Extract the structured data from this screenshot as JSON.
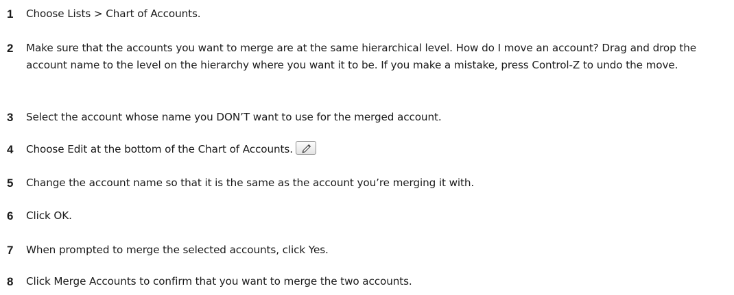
{
  "steps": [
    {
      "number": "1",
      "text": "Choose Lists > Chart of Accounts."
    },
    {
      "number": "2",
      "text": "Make sure that the accounts you want to merge are at the same hierarchical level. How do I move an account? Drag and drop the account name to the level on the hierarchy where you want it to be. If you make a mistake, press Control-Z to undo the move."
    },
    {
      "number": "3",
      "text": "Select the account whose name you DON’T want to use for the merged account."
    },
    {
      "number": "4",
      "text": "Choose Edit at the bottom of the Chart of Accounts.",
      "icon": "pencil-icon"
    },
    {
      "number": "5",
      "text": "Change the account name so that it is the same as the account you’re merging it with."
    },
    {
      "number": "6",
      "text": "Click OK."
    },
    {
      "number": "7",
      "text": "When prompted to merge the selected accounts, click Yes."
    },
    {
      "number": "8",
      "text": "Click Merge Accounts to confirm that you want to merge the two accounts."
    }
  ]
}
